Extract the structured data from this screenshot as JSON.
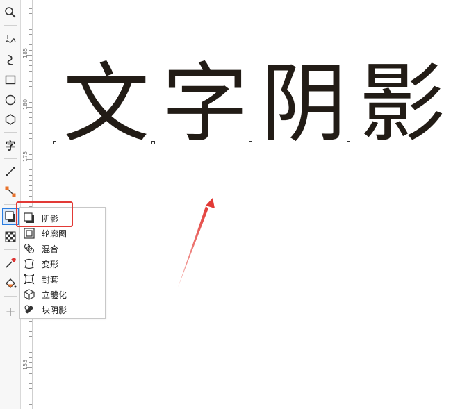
{
  "toolbox": {
    "text_tool_glyph": "字",
    "add_glyph": "+"
  },
  "ruler": {
    "labels": [
      "185",
      "180",
      "175",
      "155"
    ]
  },
  "canvas": {
    "glyphs": [
      "文",
      "字",
      "阴",
      "影"
    ],
    "text_color": "#221c16"
  },
  "flyout": {
    "items": [
      {
        "label": "阴影",
        "icon": "drop-shadow-icon"
      },
      {
        "label": "轮廓图",
        "icon": "contour-icon"
      },
      {
        "label": "混合",
        "icon": "blend-icon"
      },
      {
        "label": "变形",
        "icon": "distort-icon"
      },
      {
        "label": "封套",
        "icon": "envelope-icon"
      },
      {
        "label": "立體化",
        "icon": "extrude-icon"
      },
      {
        "label": "块阴影",
        "icon": "block-shadow-icon"
      }
    ]
  },
  "annotation": {
    "highlight_color": "#e23a36"
  }
}
